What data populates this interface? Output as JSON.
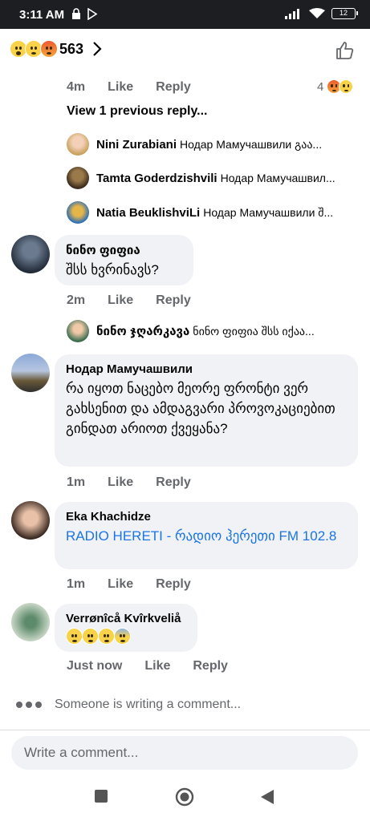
{
  "status_bar": {
    "time": "3:11 AM",
    "battery": "12"
  },
  "header": {
    "reaction_count": "563"
  },
  "top_comment_actions": {
    "time": "4m",
    "like": "Like",
    "reply": "Reply",
    "reaction_count": "4"
  },
  "view_previous": "View 1 previous reply...",
  "replies_preview": [
    {
      "name": "Nini Zurabiani",
      "text": "Нодар Мамучашвили  გაა..."
    },
    {
      "name": "Tamta Goderdzishvili",
      "text": "Нодар Мамучашвил..."
    },
    {
      "name": "Natia BeuklishviLi",
      "text": "Нодар Мамучашвили შ..."
    }
  ],
  "comments": [
    {
      "name": "ნინო ფიფია",
      "text": "შსს ხვრინავს?",
      "time": "2m",
      "like": "Like",
      "reply": "Reply"
    },
    {
      "name": "Нодар Мамучашвили",
      "text": "რა იყოთ ნაცებო მეორე ფრონტი ვერ გახსენით და ამდაგვარი პროვოკაციებით გინდათ არიოთ ქვეყანა?",
      "time": "1m",
      "like": "Like",
      "reply": "Reply"
    },
    {
      "name": "Eka Khachidze",
      "text": "RADIO HERETI - რადიო ჰერეთი  FM 102.8",
      "time": "1m",
      "like": "Like",
      "reply": "Reply"
    },
    {
      "name": "Verrønîcå Kvîrkveliå",
      "text": "",
      "time": "Just now",
      "like": "Like",
      "reply": "Reply"
    }
  ],
  "sub_reply": {
    "name": "ნინო ჯღარკავა",
    "text": "ნინო ფიფია შსს იქაა..."
  },
  "typing_indicator": "Someone is writing a comment...",
  "composer": {
    "placeholder": "Write a comment..."
  },
  "colors": {
    "link": "#1b74e4",
    "bubble": "#f0f2f5",
    "meta": "#65676b"
  }
}
